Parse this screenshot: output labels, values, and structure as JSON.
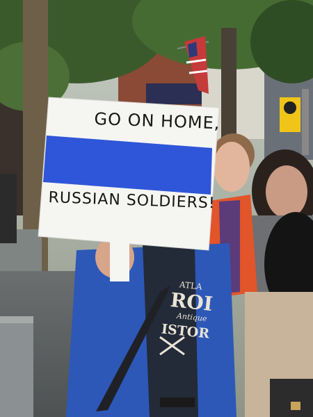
{
  "sign": {
    "line1": "GO ON HOME,",
    "line2": "RUSSIAN SOLDIERS!",
    "colors": {
      "white": "#f5f5f2",
      "blue": "#2f56d8"
    }
  },
  "tshirt": {
    "line1": "ATLA",
    "line2": "ROI",
    "line3": "Antique",
    "line4": "ISTOR"
  },
  "background": {
    "flag": "us-flag-icon",
    "transit_sign": "db-logo"
  },
  "colors": {
    "jacket": "#2d58b8",
    "orange_jacket": "#e2542a",
    "tree": "#3a5a2c",
    "brick": "#8a4a35"
  }
}
